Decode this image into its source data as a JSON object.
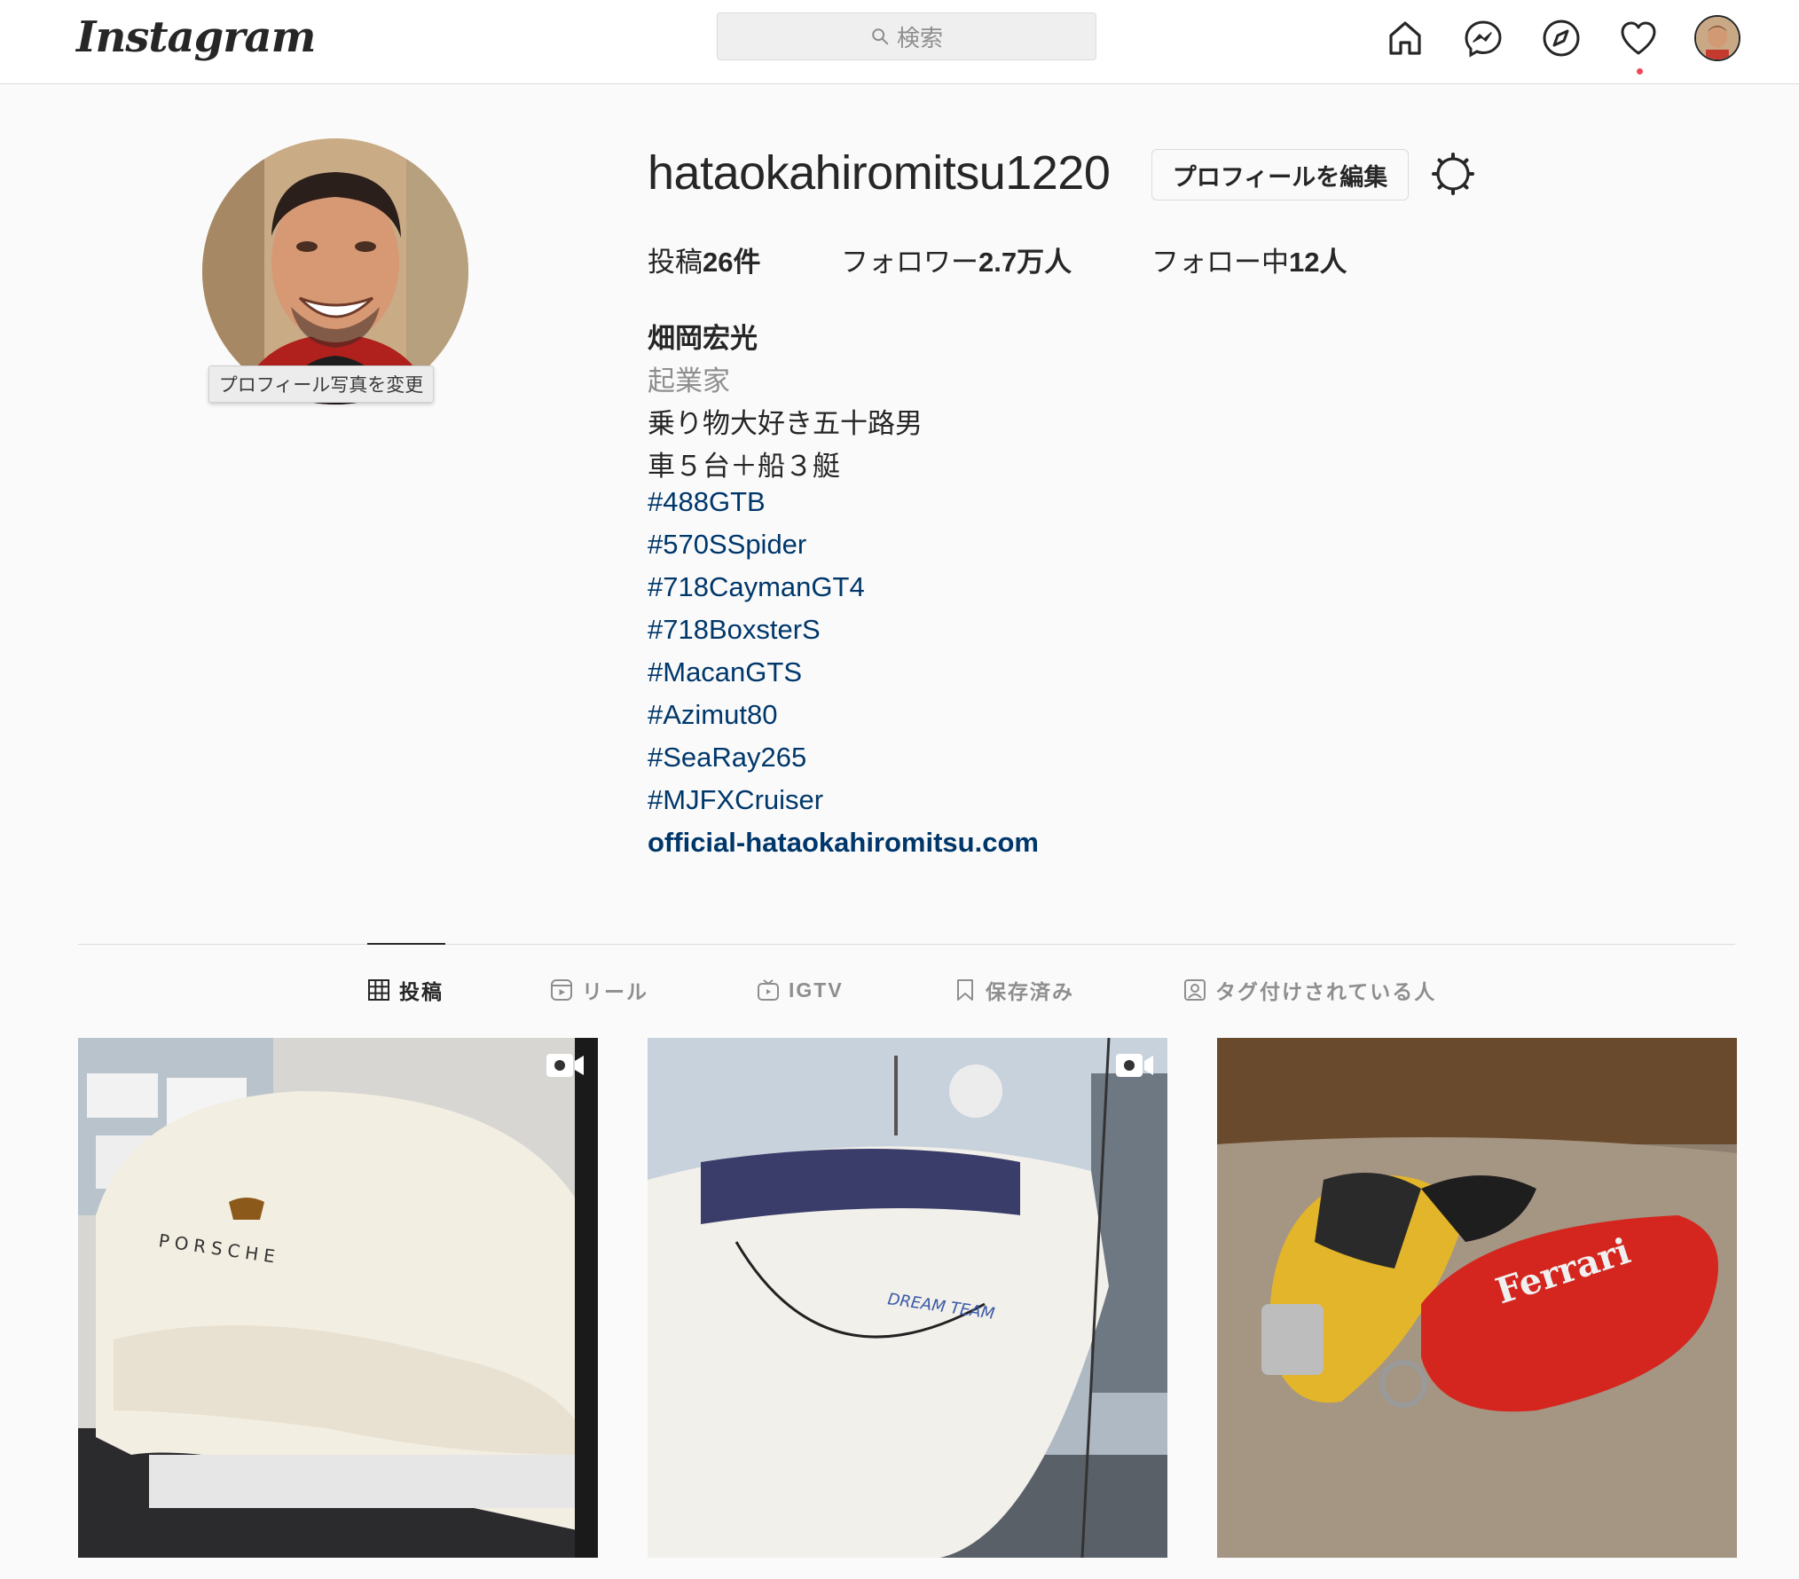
{
  "nav": {
    "logo": "Instagram",
    "search_placeholder": "検索",
    "icons": [
      "home-icon",
      "messenger-icon",
      "explore-icon",
      "activity-heart-icon",
      "profile-avatar"
    ],
    "notification_dot_color": "#ed4956"
  },
  "profile": {
    "username": "hataokahiromitsu1220",
    "edit_button": "プロフィールを編集",
    "avatar_tooltip": "プロフィール写真を変更",
    "stats": {
      "posts_prefix": "投稿",
      "posts_value": "26件",
      "followers_prefix": "フォロワー",
      "followers_value": "2.7万人",
      "following_prefix": "フォロー中",
      "following_value": "12人"
    },
    "bio": {
      "name": "畑岡宏光",
      "category": "起業家",
      "lines": [
        "乗り物大好き五十路男",
        "車５台＋船３艇"
      ],
      "hashtags": [
        "#488GTB",
        "#570SSpider",
        "#718CaymanGT4",
        "#718BoxsterS",
        "#MacanGTS",
        "#Azimut80",
        "#SeaRay265",
        "#MJFXCruiser"
      ],
      "website": "official-hataokahiromitsu.com"
    }
  },
  "tabs": [
    {
      "label": "投稿",
      "icon": "grid-icon",
      "active": true
    },
    {
      "label": "リール",
      "icon": "reels-icon",
      "active": false
    },
    {
      "label": "IGTV",
      "icon": "igtv-icon",
      "active": false
    },
    {
      "label": "保存済み",
      "icon": "bookmark-icon",
      "active": false
    },
    {
      "label": "タグ付けされている人",
      "icon": "tagged-icon",
      "active": false
    }
  ],
  "posts": [
    {
      "subject": "Porsche car under cover",
      "type": "video"
    },
    {
      "subject": "Yacht DREAM TEAM",
      "type": "video"
    },
    {
      "subject": "Porsche and Ferrari keys",
      "type": "image"
    }
  ],
  "colors": {
    "link": "#00376b",
    "border": "#dbdbdb",
    "muted": "#8e8e8e",
    "text": "#262626"
  }
}
